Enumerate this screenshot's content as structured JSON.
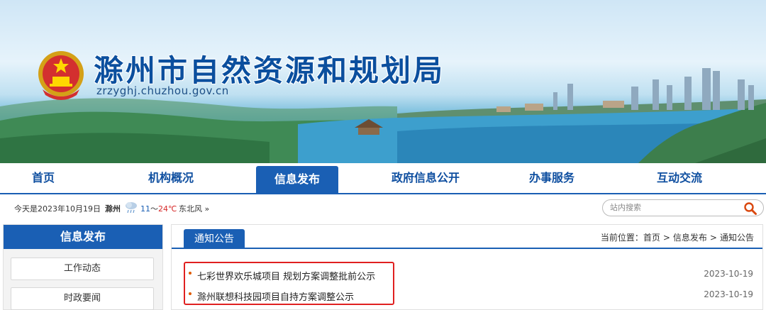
{
  "site": {
    "title": "滁州市自然资源和规划局",
    "url": "zrzyghj.chuzhou.gov.cn"
  },
  "nav": {
    "items": [
      {
        "label": "首页",
        "active": false
      },
      {
        "label": "机构概况",
        "active": false
      },
      {
        "label": "信息发布",
        "active": true
      },
      {
        "label": "政府信息公开",
        "active": false
      },
      {
        "label": "办事服务",
        "active": false
      },
      {
        "label": "互动交流",
        "active": false
      }
    ]
  },
  "infobar": {
    "date_text": "今天是2023年10月19日",
    "city": "滁州",
    "temp_low": "11",
    "temp_sep": "～",
    "temp_high": "24℃",
    "wind": "东北风 »",
    "weather_icon": "cloud-rain-icon"
  },
  "search": {
    "placeholder": "站内搜索"
  },
  "sidebar": {
    "title": "信息发布",
    "items": [
      {
        "label": "工作动态"
      },
      {
        "label": "时政要闻"
      }
    ]
  },
  "main": {
    "tab": "通知公告",
    "breadcrumb": {
      "prefix": "当前位置：",
      "items": [
        "首页",
        "信息发布",
        "通知公告"
      ],
      "separator": ">"
    },
    "notices": [
      {
        "title": "七彩世界欢乐城项目 规划方案调整批前公示",
        "date": "2023-10-19"
      },
      {
        "title": "滁州联想科技园项目自持方案调整公示",
        "date": "2023-10-19"
      }
    ]
  },
  "colors": {
    "brand_blue": "#1a5fb4",
    "title_blue": "#0b4f9e",
    "highlight_red": "#e02020",
    "temp_high_red": "#d62828"
  }
}
